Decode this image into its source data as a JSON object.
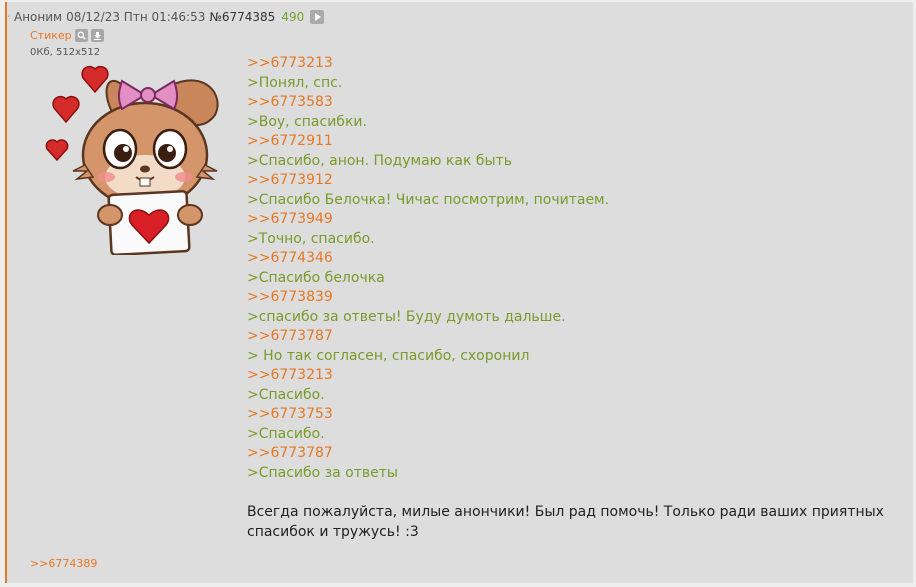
{
  "post": {
    "author": "Аноним",
    "date": "08/12/23 Птн 01:46:53",
    "number": "№6774385",
    "count": "490",
    "corner_mark": "·"
  },
  "file": {
    "name": "Стикер",
    "meta": "0Кб, 512x512",
    "search_icon": "search-icon",
    "download_icon": "download-icon"
  },
  "message": {
    "lines": [
      {
        "type": "reply",
        "text": ">>6773213"
      },
      {
        "type": "quote",
        "text": ">Понял, спс."
      },
      {
        "type": "reply",
        "text": ">>6773583"
      },
      {
        "type": "quote",
        "text": ">Воу, спасибки."
      },
      {
        "type": "reply",
        "text": ">>6772911"
      },
      {
        "type": "quote",
        "text": ">Спасибо, анон. Подумаю как быть"
      },
      {
        "type": "reply",
        "text": ">>6773912"
      },
      {
        "type": "quote",
        "text": ">Спасибо Белочка! Чичас посмотрим, почитаем."
      },
      {
        "type": "reply",
        "text": ">>6773949"
      },
      {
        "type": "quote",
        "text": ">Точно, спасибо."
      },
      {
        "type": "reply",
        "text": ">>6774346"
      },
      {
        "type": "quote",
        "text": ">Спасибо белочка"
      },
      {
        "type": "reply",
        "text": ">>6773839"
      },
      {
        "type": "quote",
        "text": ">спасибо за ответы! Буду думоть дальше."
      },
      {
        "type": "reply",
        "text": ">>6773787"
      },
      {
        "type": "quote",
        "text": "> Но так согласен, спасибо, схоронил"
      },
      {
        "type": "reply",
        "text": ">>6773213"
      },
      {
        "type": "quote",
        "text": ">Спасибо."
      },
      {
        "type": "reply",
        "text": ">>6773753"
      },
      {
        "type": "quote",
        "text": ">Спасибо."
      },
      {
        "type": "reply",
        "text": ">>6773787"
      },
      {
        "type": "quote",
        "text": ">Спасибо за ответы"
      }
    ],
    "closing": "Всегда пожалуйста, милые анончики! Был рад помочь! Только ради ваших приятных спасибок и тружусь! :3"
  },
  "replies": ">>6774389",
  "colors": {
    "accent": "#e87722",
    "quote": "#7a9a2a",
    "post_bg": "#dddddd"
  }
}
